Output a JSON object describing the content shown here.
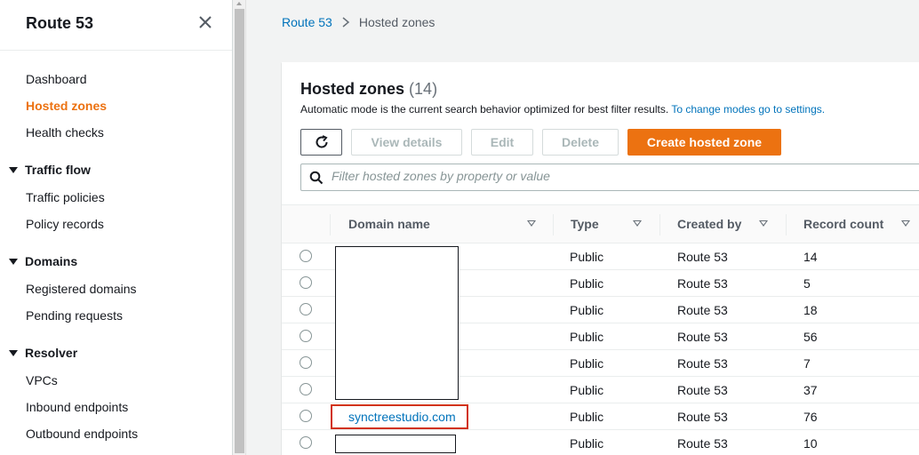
{
  "sidebar": {
    "title": "Route 53",
    "items": [
      {
        "label": "Dashboard"
      },
      {
        "label": "Hosted zones",
        "active": true
      },
      {
        "label": "Health checks"
      }
    ],
    "sections": [
      {
        "label": "Traffic flow",
        "items": [
          "Traffic policies",
          "Policy records"
        ]
      },
      {
        "label": "Domains",
        "items": [
          "Registered domains",
          "Pending requests"
        ]
      },
      {
        "label": "Resolver",
        "items": [
          "VPCs",
          "Inbound endpoints",
          "Outbound endpoints"
        ]
      }
    ]
  },
  "breadcrumb": {
    "root": "Route 53",
    "current": "Hosted zones"
  },
  "panel": {
    "title": "Hosted zones",
    "count": "(14)",
    "description": "Automatic mode is the current search behavior optimized for best filter results.",
    "description_link": "To change modes go to settings."
  },
  "actions": {
    "refresh_icon": "refresh-icon",
    "view_details": "View details",
    "edit": "Edit",
    "delete": "Delete",
    "create": "Create hosted zone"
  },
  "filter": {
    "placeholder": "Filter hosted zones by property or value",
    "icon": "search-icon"
  },
  "table": {
    "columns": [
      "Domain name",
      "Type",
      "Created by",
      "Record count"
    ],
    "rows": [
      {
        "domain": "",
        "type": "Public",
        "created_by": "Route 53",
        "record_count": "14"
      },
      {
        "domain": "",
        "type": "Public",
        "created_by": "Route 53",
        "record_count": "5"
      },
      {
        "domain": "",
        "type": "Public",
        "created_by": "Route 53",
        "record_count": "18"
      },
      {
        "domain": "",
        "type": "Public",
        "created_by": "Route 53",
        "record_count": "56"
      },
      {
        "domain": "",
        "type": "Public",
        "created_by": "Route 53",
        "record_count": "7"
      },
      {
        "domain": "",
        "type": "Public",
        "created_by": "Route 53",
        "record_count": "37"
      },
      {
        "domain": "synctreestudio.com",
        "type": "Public",
        "created_by": "Route 53",
        "record_count": "76"
      },
      {
        "domain": "",
        "type": "Public",
        "created_by": "Route 53",
        "record_count": "10"
      }
    ]
  },
  "colors": {
    "accent": "#ec7211",
    "link": "#0073bb",
    "highlight": "#d13212"
  }
}
